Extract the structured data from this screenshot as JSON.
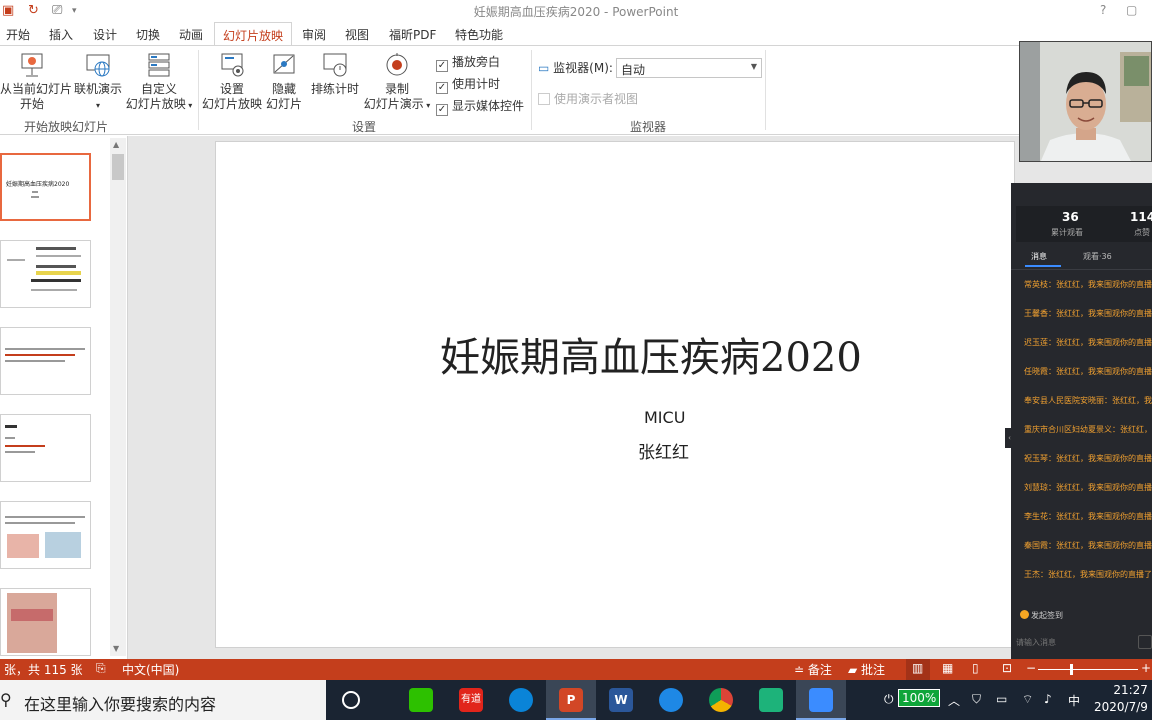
{
  "window": {
    "title": "妊娠期高血压疾病2020 - PowerPoint",
    "controls": [
      "?",
      "▢"
    ]
  },
  "ribbon_tabs": [
    "开始",
    "插入",
    "设计",
    "切换",
    "动画",
    "幻灯片放映",
    "审阅",
    "视图",
    "福昕PDF",
    "特色功能"
  ],
  "ribbon": {
    "start_group": {
      "from_current_line1": "从当前幻灯片",
      "from_current_line2": "开始",
      "online_present": "联机演示",
      "custom_line1": "自定义",
      "custom_line2": "幻灯片放映",
      "label": "开始放映幻灯片"
    },
    "setup_group": {
      "setup_line1": "设置",
      "setup_line2": "幻灯片放映",
      "hide_line1": "隐藏",
      "hide_line2": "幻灯片",
      "rehearse": "排练计时",
      "record_line1": "录制",
      "record_line2": "幻灯片演示",
      "checkboxes": [
        {
          "label": "播放旁白",
          "checked": true
        },
        {
          "label": "使用计时",
          "checked": true
        },
        {
          "label": "显示媒体控件",
          "checked": true
        }
      ],
      "label": "设置"
    },
    "monitor_group": {
      "monitor_label": "监视器(M):",
      "monitor_value": "自动",
      "presenter_view": "使用演示者视图",
      "label": "监视器"
    }
  },
  "thumbnails": {
    "first_title": "妊娠期高血压疾病2020"
  },
  "slide": {
    "title": "妊娠期高血压疾病2020",
    "subtitle1": "MICU",
    "subtitle2": "张红红"
  },
  "live_panel": {
    "stats": [
      {
        "value": "36",
        "label": "累计观看"
      },
      {
        "value": "114",
        "label": "点赞"
      }
    ],
    "tabs": [
      "消息",
      "观看·36"
    ],
    "messages": [
      "常英枝：张红红，我来围观你的直播了，为你点赞！",
      "王馨香：张红红，我来围观你的直播了，为你点赞！",
      "迟玉莲：张红红，我来围观你的直播了，为你点赞！",
      "任晓霞：张红红，我来围观你的直播了，为你点赞！",
      "奉安县人民医院安晓丽：张红红，我来围观你的直播啦，为你点赞！",
      "重庆市合川区妇幼夏景义：张红红，我来围观你的直播啦，为你点赞！",
      "祝玉琴：张红红，我来围观你的直播了，为你点赞！",
      "刘慧琼：张红红，我来围观你的直播了，为你点赞！",
      "李生花：张红红，我来围观你的直播了，为你点赞！",
      "秦国霞：张红红，我来围观你的直播了，为你点赞！",
      "王杰：张红红，我来围观你的直播了，为你点赞！"
    ],
    "signin": "发起签到",
    "input_placeholder": "请输入消息"
  },
  "status_bar": {
    "slide_info": "张，共 115 张",
    "language": "中文(中国)",
    "notes": "备注",
    "comments": "批注"
  },
  "taskbar": {
    "search_placeholder": "在这里输入你要搜索的内容",
    "youdao": "有道",
    "battery": "100%",
    "ime": "中",
    "time": "21:27",
    "date": "2020/7/9"
  },
  "colors": {
    "accent": "#c43e1c",
    "taskbar": "#1a2432",
    "live_panel": "#26282d",
    "chat_text": "#f0a030"
  }
}
